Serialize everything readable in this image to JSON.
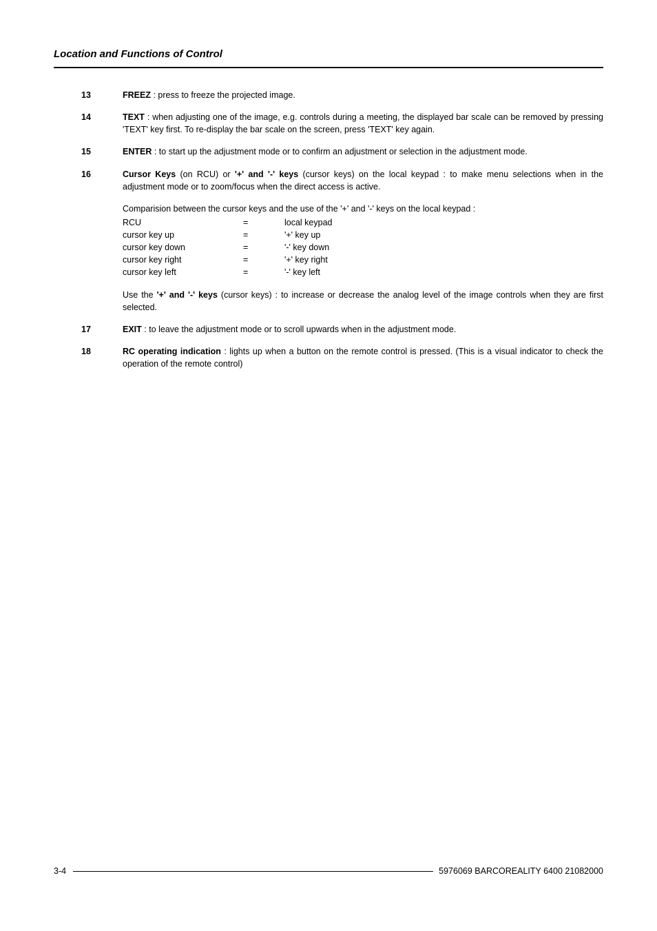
{
  "header": {
    "title": "Location and Functions of Control"
  },
  "items": [
    {
      "num": "13",
      "label": "FREEZ",
      "text": " : press to freeze the projected image."
    },
    {
      "num": "14",
      "label": "TEXT",
      "text": " : when adjusting one of the image, e.g. controls during a meeting, the displayed bar scale can be removed by pressing 'TEXT' key first.  To re-display the bar scale on the screen, press 'TEXT' key again."
    },
    {
      "num": "15",
      "label": "ENTER",
      "text": " : to start up the adjustment mode or to confirm an adjustment or selection in the adjustment mode."
    },
    {
      "num": "16",
      "label": "Cursor Keys",
      "mid": " (on RCU) or ",
      "label2": "'+' and '-' keys",
      "text": " (cursor keys) on the local keypad : to make menu selections when in the adjustment mode or to zoom/focus when the direct access is active.",
      "comparison_intro": "Comparision between the cursor keys and the use of the '+' and '-' keys on the local keypad :",
      "comparison_rows": [
        {
          "c1": "RCU",
          "c2": "=",
          "c3": "local keypad"
        },
        {
          "c1": "cursor key up",
          "c2": "=",
          "c3": "'+' key up"
        },
        {
          "c1": "cursor key down",
          "c2": "=",
          "c3": "'-' key down"
        },
        {
          "c1": "cursor key right",
          "c2": "=",
          "c3": "'+' key right"
        },
        {
          "c1": "cursor key left",
          "c2": "=",
          "c3": "'-' key left"
        }
      ],
      "use_pre": "Use  the ",
      "use_label": "'+' and '-' keys",
      "use_post": " (cursor keys) : to increase or decrease the analog level of the image controls when they are first selected."
    },
    {
      "num": "17",
      "label": "EXIT",
      "text": " :  to leave the adjustment mode or to scroll upwards when in the adjustment mode."
    },
    {
      "num": "18",
      "label": "RC operating indication",
      "text": " : lights up when a button on the remote control is pressed.  (This is a visual indicator to check the operation of the remote control)"
    }
  ],
  "footer": {
    "page": "3-4",
    "doc": "5976069 BARCOREALITY 6400 21082000"
  }
}
